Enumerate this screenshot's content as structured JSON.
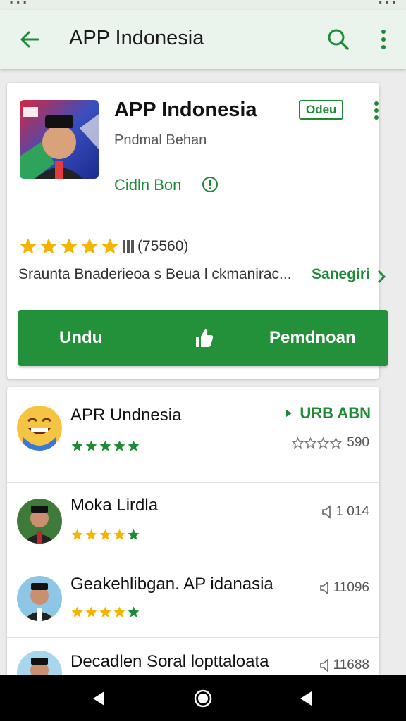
{
  "app_bar": {
    "title": "APP Indonesia"
  },
  "app": {
    "name": "APP Indonesia",
    "developer": "Pndmal Behan",
    "category": "Cidln Bon",
    "badge": "Odeu",
    "rating_count": "(75560)",
    "description": "Sraunta Bnaderieoa s Beua l ckmanirac...",
    "see_more_label": "Sanegiri",
    "download_label": "Undu",
    "install_label": "Pemdnoan"
  },
  "list": {
    "items": [
      {
        "name": "APR Undnesia",
        "tag": "URB ABN",
        "meta": "590"
      },
      {
        "name": "Moka Lirdla",
        "meta": "1 014"
      },
      {
        "name": "Geakehlibgan. AP idanasia",
        "meta": "11096"
      },
      {
        "name": "Decadlen Soral lopttaloata",
        "meta": "11688"
      }
    ]
  },
  "colors": {
    "brand_green": "#23913a",
    "text_green": "#1e8a36",
    "star_yellow": "#f5b400"
  },
  "icons": {
    "back": "arrow-left-icon",
    "search": "search-icon",
    "more": "more-vert-icon",
    "like": "thumbs-up-icon",
    "info": "info-icon",
    "nav_back": "triangle-back-icon",
    "nav_home": "circle-home-icon",
    "nav_recent": "triangle-recent-icon"
  }
}
